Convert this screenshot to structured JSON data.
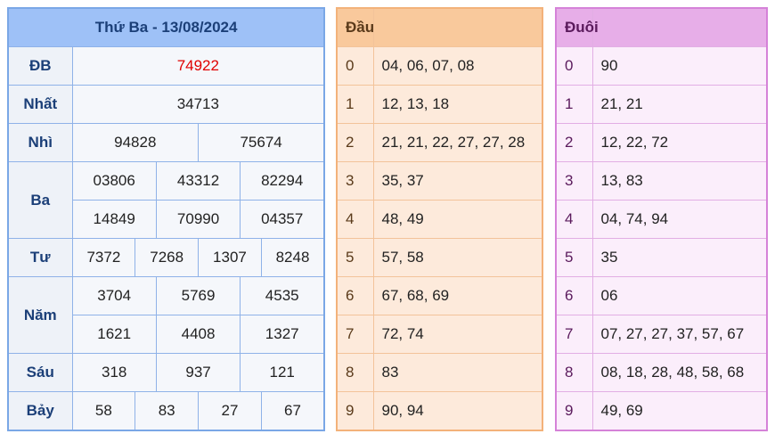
{
  "results": {
    "title": "Thứ Ba - 13/08/2024",
    "rows": {
      "db": {
        "label": "ĐB",
        "values": [
          "74922"
        ]
      },
      "nhat": {
        "label": "Nhất",
        "values": [
          "34713"
        ]
      },
      "nhi": {
        "label": "Nhì",
        "values": [
          "94828",
          "75674"
        ]
      },
      "ba": {
        "label": "Ba",
        "values": [
          "03806",
          "43312",
          "82294",
          "14849",
          "70990",
          "04357"
        ]
      },
      "tu": {
        "label": "Tư",
        "values": [
          "7372",
          "7268",
          "1307",
          "8248"
        ]
      },
      "nam": {
        "label": "Năm",
        "values": [
          "3704",
          "5769",
          "4535",
          "1621",
          "4408",
          "1327"
        ]
      },
      "sau": {
        "label": "Sáu",
        "values": [
          "318",
          "937",
          "121"
        ]
      },
      "bay": {
        "label": "Bảy",
        "values": [
          "58",
          "83",
          "27",
          "67"
        ]
      }
    }
  },
  "dau": {
    "header": "Đầu",
    "header2": "",
    "rows": [
      {
        "k": "0",
        "v": "04, 06, 07, 08"
      },
      {
        "k": "1",
        "v": "12, 13, 18"
      },
      {
        "k": "2",
        "v": "21, 21, 22, 27, 27, 28"
      },
      {
        "k": "3",
        "v": "35, 37"
      },
      {
        "k": "4",
        "v": "48, 49"
      },
      {
        "k": "5",
        "v": "57, 58"
      },
      {
        "k": "6",
        "v": "67, 68, 69"
      },
      {
        "k": "7",
        "v": "72, 74"
      },
      {
        "k": "8",
        "v": "83"
      },
      {
        "k": "9",
        "v": "90, 94"
      }
    ]
  },
  "duoi": {
    "header": "Đuôi",
    "header2": "",
    "rows": [
      {
        "k": "0",
        "v": "90"
      },
      {
        "k": "1",
        "v": "21, 21"
      },
      {
        "k": "2",
        "v": "12, 22, 72"
      },
      {
        "k": "3",
        "v": "13, 83"
      },
      {
        "k": "4",
        "v": "04, 74, 94"
      },
      {
        "k": "5",
        "v": "35"
      },
      {
        "k": "6",
        "v": "06"
      },
      {
        "k": "7",
        "v": "07, 27, 27, 37, 57, 67"
      },
      {
        "k": "8",
        "v": "08, 18, 28, 48, 58, 68"
      },
      {
        "k": "9",
        "v": "49, 69"
      }
    ]
  },
  "colors": {
    "special_prize": "#e00000",
    "results_header": "#9ec1f7",
    "dau_header": "#f9c99c",
    "duoi_header": "#e7aee8"
  }
}
